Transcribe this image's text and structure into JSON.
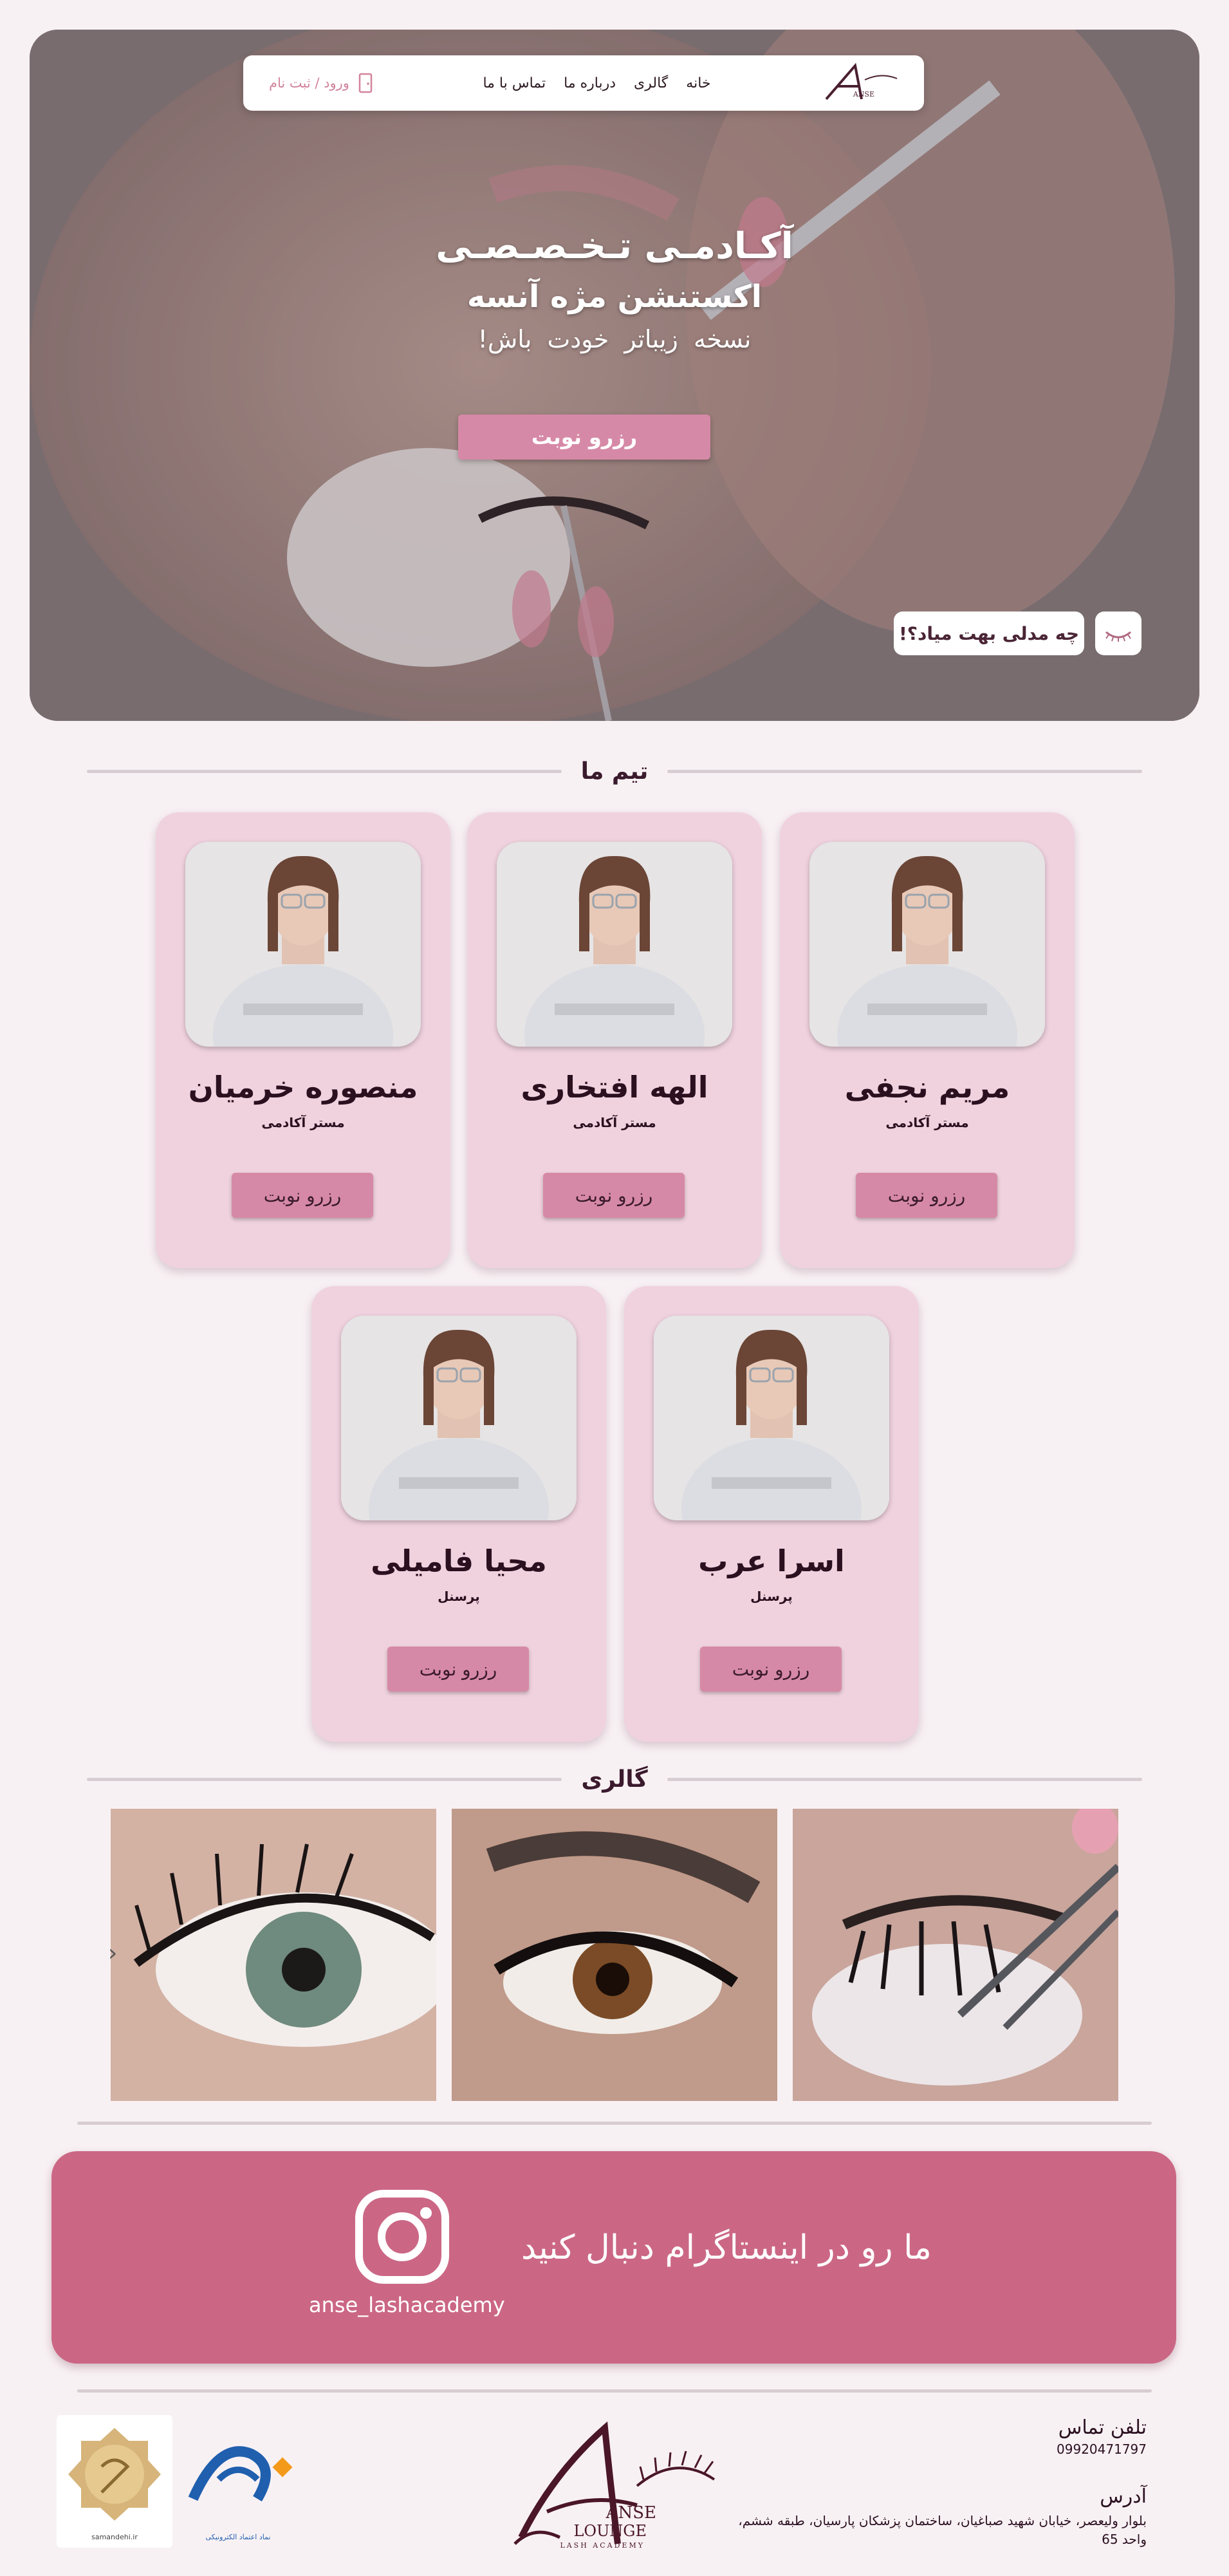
{
  "nav": {
    "logo_alt": "ANSE LASH ACADEMY",
    "links": [
      "خانه",
      "گالری",
      "درباره ما",
      "تماس با ما"
    ],
    "login_label": "ورود / ثبت نام"
  },
  "hero": {
    "line1": "آکـادمـی تـخـصـصـی",
    "line2": "اکستنشن مژه آنسه",
    "line3": "نسخه زیباتر خودت باش!",
    "cta": "رزرو نوبت",
    "style_prompt": "چه مدلی بهت میاد؟!"
  },
  "team": {
    "title": "تیم ما",
    "members": [
      {
        "name": "مریم نجفی",
        "role": "مستر آکادمی",
        "button": "رزرو نوبت"
      },
      {
        "name": "الهه افتخاری",
        "role": "مستر آکادمی",
        "button": "رزرو نوبت"
      },
      {
        "name": "منصوره خرمیان",
        "role": "مستر آکادمی",
        "button": "رزرو نوبت"
      },
      {
        "name": "اسرا عرب",
        "role": "پرسنل",
        "button": "رزرو نوبت"
      },
      {
        "name": "محیا فامیلی",
        "role": "پرسنل",
        "button": "رزرو نوبت"
      }
    ]
  },
  "gallery": {
    "title": "گالری",
    "prev_icon": "chevron-left-icon"
  },
  "instagram": {
    "handle": "anse_lashacademy",
    "text": "ما رو در اینستاگرام دنبال کنید",
    "color": "#cb6785"
  },
  "footer": {
    "phone_label": "تلفن تماس",
    "phone": "09920471797",
    "address_label": "آدرس",
    "address": "بلوار ولیعصر، خیابان شهید صباغیان، ساختمان پزشکان پارسیان، طبقه ششم، واحد 65",
    "brand_line1": "ANSE",
    "brand_line2": "LOUNGE",
    "brand_line3": "LASH ACADEMY",
    "enamad_caption": "نماد اعتماد الکترونیکی",
    "samandehi_caption": "samandehi.ir"
  },
  "colors": {
    "accent": "#d689a6",
    "card_bg": "#f0d2de",
    "page_bg": "#f8f1f4"
  }
}
